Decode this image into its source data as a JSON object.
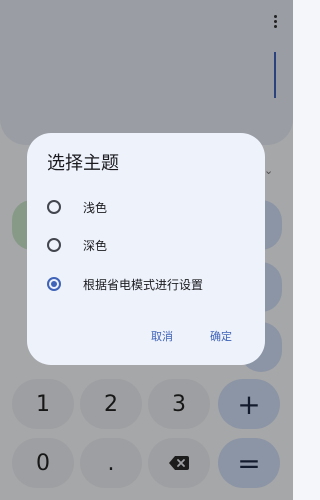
{
  "calculator": {
    "keys": {
      "one": "1",
      "two": "2",
      "three": "3",
      "plus": "+",
      "zero": "0",
      "decimal": ".",
      "equals": "="
    }
  },
  "dialog": {
    "title": "选择主题",
    "options": [
      {
        "label": "浅色",
        "selected": false
      },
      {
        "label": "深色",
        "selected": false
      },
      {
        "label": "根据省电模式进行设置",
        "selected": true
      }
    ],
    "cancel_label": "取消",
    "confirm_label": "确定"
  },
  "colors": {
    "accent": "#3f63b8",
    "dialog_background": "#eef2fb"
  }
}
